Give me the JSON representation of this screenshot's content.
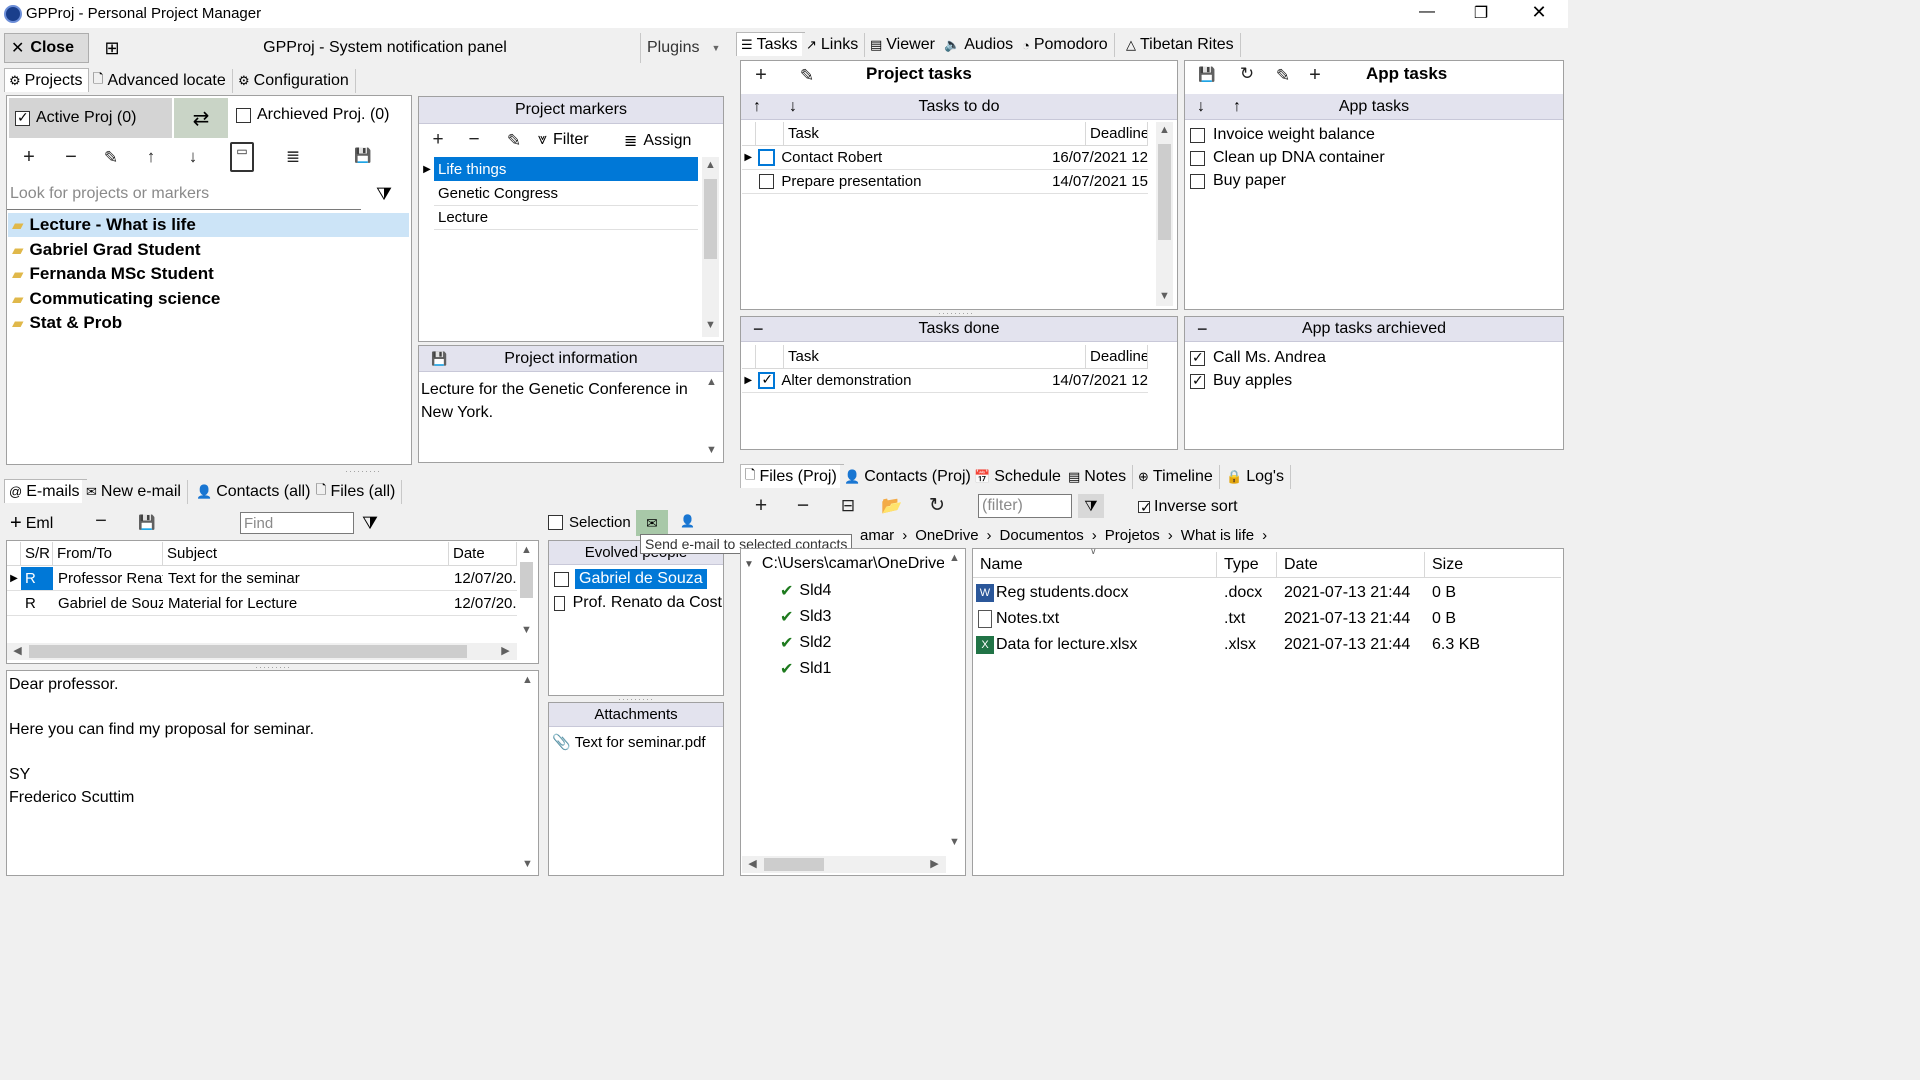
{
  "window": {
    "title": "GPProj - Personal Project Manager",
    "controls": {
      "minimize": "—",
      "restore": "❐",
      "close": "✕"
    }
  },
  "topbar": {
    "close_label": "Close",
    "notification_title": "GPProj - System notification panel",
    "plugins_label": "Plugins"
  },
  "left_tabs": [
    "Projects",
    "Advanced locate",
    "Configuration"
  ],
  "projects": {
    "active_label": "Active Proj (0)",
    "archived_label": "Archieved Proj. (0)",
    "search_placeholder": "Look for projects or markers",
    "items": [
      "Lecture - What is life",
      "Gabriel Grad Student",
      "Fernanda MSc Student",
      "Commuticating science",
      "Stat & Prob"
    ]
  },
  "markers": {
    "title": "Project markers",
    "filter_label": "Filter",
    "assign_label": "Assign",
    "items": [
      "Life things",
      "Genetic Congress",
      "Lecture"
    ]
  },
  "project_info": {
    "title": "Project information",
    "text": "Lecture for the Genetic Conference in New York."
  },
  "right_tabs": [
    "Tasks",
    "Links",
    "Viewer",
    "Audios",
    "Pomodoro",
    "Tibetan Rites"
  ],
  "project_tasks": {
    "title": "Project tasks",
    "todo_header": "Tasks to do",
    "col_task": "Task",
    "col_deadline": "Deadline",
    "todo": [
      {
        "task": "Contact Robert",
        "deadline": "16/07/2021 12"
      },
      {
        "task": "Prepare presentation",
        "deadline": "14/07/2021 15"
      }
    ],
    "done_header": "Tasks done",
    "done": [
      {
        "task": "Alter demonstration",
        "deadline": "14/07/2021 12"
      }
    ]
  },
  "app_tasks": {
    "title": "App tasks",
    "sub_header": "App tasks",
    "items": [
      "Invoice weight balance",
      "Clean up DNA container",
      "Buy paper"
    ],
    "archived_header": "App tasks archieved",
    "archived": [
      "Call Ms. Andrea",
      "Buy apples"
    ]
  },
  "email_tabs": [
    "E-mails",
    "New e-mail",
    "Contacts (all)",
    "Files (all)"
  ],
  "emails": {
    "add_label": "Eml",
    "find_placeholder": "Find",
    "cols": [
      "S/R",
      "From/To",
      "Subject",
      "Date"
    ],
    "rows": [
      {
        "sr": "R",
        "from": "Professor Renat",
        "subject": "Text for the seminar",
        "date": "12/07/20."
      },
      {
        "sr": "R",
        "from": "Gabriel de Souz",
        "subject": "Material for Lecture",
        "date": "12/07/20."
      }
    ],
    "body_lines": [
      "Dear professor.",
      "",
      "Here you can find my proposal for seminar.",
      "",
      "SY",
      "Frederico Scuttim"
    ]
  },
  "contacts": {
    "selection_label": "Selection",
    "tooltip": "Send e-mail to selected contacts",
    "evolved_header": "Evolved people",
    "items": [
      "Gabriel de Souza",
      "Prof. Renato da Cost"
    ],
    "attachments_header": "Attachments",
    "attachments": [
      "Text for seminar.pdf"
    ]
  },
  "file_tabs": [
    "Files (Proj)",
    "Contacts (Proj)",
    "Schedule",
    "Notes",
    "Timeline",
    "Log's"
  ],
  "files": {
    "filter_placeholder": "(filter)",
    "inverse_label": "Inverse sort",
    "breadcrumb": [
      "amar",
      "OneDrive",
      "Documentos",
      "Projetos",
      "What is life"
    ],
    "tree_root": "C:\\Users\\camar\\OneDrive",
    "tree_items": [
      "Sld4",
      "Sld3",
      "Sld2",
      "Sld1"
    ],
    "cols": [
      "Name",
      "Type",
      "Date",
      "Size"
    ],
    "rows": [
      {
        "name": "Reg students.docx",
        "type": ".docx",
        "date": "2021-07-13 21:44",
        "size": "0 B"
      },
      {
        "name": "Notes.txt",
        "type": ".txt",
        "date": "2021-07-13 21:44",
        "size": "0 B"
      },
      {
        "name": "Data for lecture.xlsx",
        "type": ".xlsx",
        "date": "2021-07-13 21:44",
        "size": "6.3 KB"
      }
    ]
  }
}
